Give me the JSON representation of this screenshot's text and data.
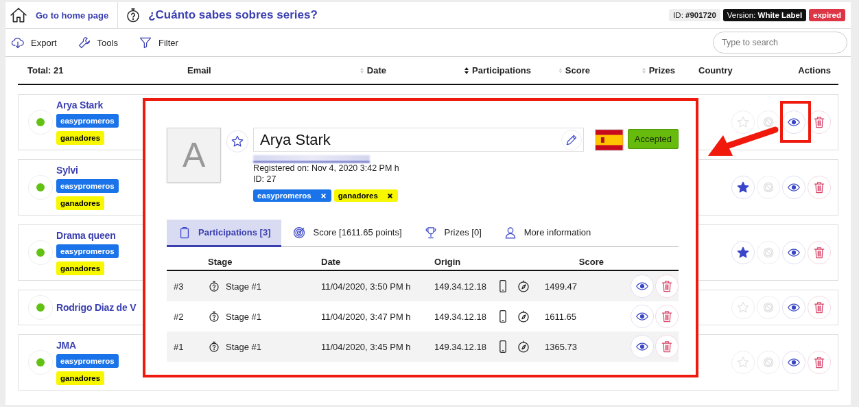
{
  "header": {
    "home_link": "Go to home page",
    "title": "¿Cuánto sabes sobres series?",
    "id_label": "ID:",
    "id_value": "#901720",
    "version_label": "Version:",
    "version_value": "White Label",
    "status": "expired"
  },
  "toolbar": {
    "items": [
      {
        "label": "Export",
        "kind": "export"
      },
      {
        "label": "Tools",
        "kind": "tools"
      },
      {
        "label": "Filter",
        "kind": "filter"
      }
    ],
    "search": {
      "placeholder": "Type to search"
    }
  },
  "table": {
    "total": "Total: 21",
    "columns": [
      {
        "label": "Email",
        "kind": "plain"
      },
      {
        "label": "Date",
        "kind": "sortable"
      },
      {
        "label": "Participations",
        "kind": "sorted"
      },
      {
        "label": "Score",
        "kind": "sortable"
      },
      {
        "label": "Prizes",
        "kind": "sortable"
      },
      {
        "label": "Country",
        "kind": "plain"
      },
      {
        "label": "Actions",
        "kind": "plain"
      }
    ],
    "rows": [
      {
        "name": "Arya Stark",
        "online": true,
        "favorite": false,
        "tags": [
          {
            "label": "easypromeros",
            "color": "#1a73e8"
          },
          {
            "label": "ganadores",
            "color": "#f7f700"
          }
        ]
      },
      {
        "name": "Sylvi",
        "online": true,
        "favorite": true,
        "tags": [
          {
            "label": "easypromeros",
            "color": "#1a73e8"
          },
          {
            "label": "ganadores",
            "color": "#f7f700"
          }
        ]
      },
      {
        "name": "Drama queen",
        "online": true,
        "favorite": true,
        "tags": [
          {
            "label": "easypromeros",
            "color": "#1a73e8"
          },
          {
            "label": "ganadores",
            "color": "#f7f700"
          }
        ]
      },
      {
        "name": "Rodrigo Diaz de V",
        "online": true,
        "favorite": false,
        "tags": []
      },
      {
        "name": "JMA",
        "online": true,
        "favorite": false,
        "tags": [
          {
            "label": "easypromeros",
            "color": "#1a73e8"
          },
          {
            "label": "ganadores",
            "color": "#f7f700"
          }
        ]
      }
    ]
  },
  "detail": {
    "avatar_letter": "A",
    "favorite": false,
    "name": "Arya Stark",
    "registered": "Registered on: Nov 4, 2020 3:42 PM h",
    "id": "ID: 27",
    "tags": [
      {
        "label": "easypromeros",
        "color": "#1a73e8"
      },
      {
        "label": "ganadores",
        "color": "#f7f700"
      }
    ],
    "status": "Accepted",
    "tabs": [
      {
        "label": "Participations [3]",
        "kind": "clipboard",
        "selected": true
      },
      {
        "label": "Score [1611.65 points]",
        "kind": "target",
        "selected": false
      },
      {
        "label": "Prizes [0]",
        "kind": "trophy",
        "selected": false
      },
      {
        "label": "More information",
        "kind": "user",
        "selected": false
      }
    ],
    "columns": [
      "Stage",
      "Date",
      "Origin",
      "Score"
    ],
    "participations": [
      {
        "number": "#3",
        "stage": "Stage #1",
        "date": "11/04/2020, 3:50 PM h",
        "origin": "149.34.12.18",
        "score": "1499.47"
      },
      {
        "number": "#2",
        "stage": "Stage #1",
        "date": "11/04/2020, 3:47 PM h",
        "origin": "149.34.12.18",
        "score": "1611.65"
      },
      {
        "number": "#1",
        "stage": "Stage #1",
        "date": "11/04/2020, 3:45 PM h",
        "origin": "149.34.12.18",
        "score": "1365.73"
      }
    ]
  }
}
